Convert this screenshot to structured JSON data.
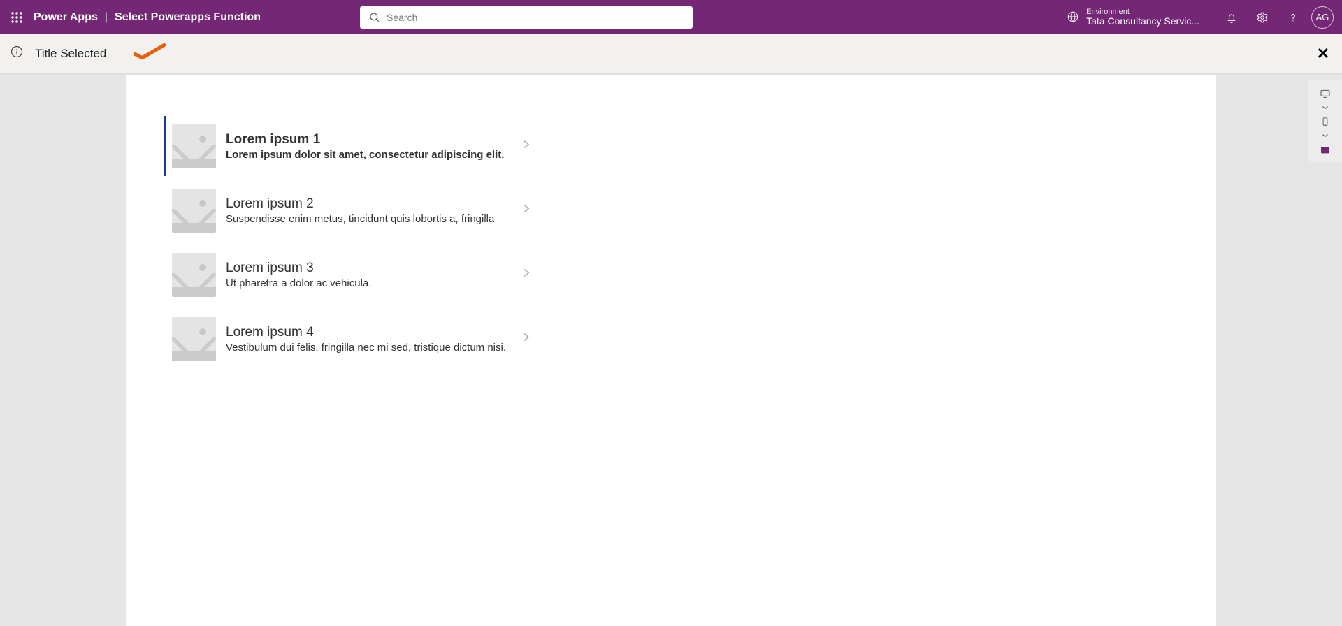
{
  "header": {
    "app_name": "Power Apps",
    "page_title": "Select Powerapps Function",
    "search_placeholder": "Search",
    "environment_label": "Environment",
    "environment_value": "Tata Consultancy Servic...",
    "avatar_initials": "AG"
  },
  "notification": {
    "text": "Title Selected"
  },
  "gallery": {
    "items": [
      {
        "title": "Lorem ipsum 1",
        "subtitle": "Lorem ipsum dolor sit amet, consectetur adipiscing elit.",
        "selected": true
      },
      {
        "title": "Lorem ipsum 2",
        "subtitle": "Suspendisse enim metus, tincidunt quis lobortis a, fringilla",
        "selected": false
      },
      {
        "title": "Lorem ipsum 3",
        "subtitle": "Ut pharetra a dolor ac vehicula.",
        "selected": false
      },
      {
        "title": "Lorem ipsum 4",
        "subtitle": "Vestibulum dui felis, fringilla nec mi sed, tristique dictum nisi.",
        "selected": false
      }
    ]
  }
}
